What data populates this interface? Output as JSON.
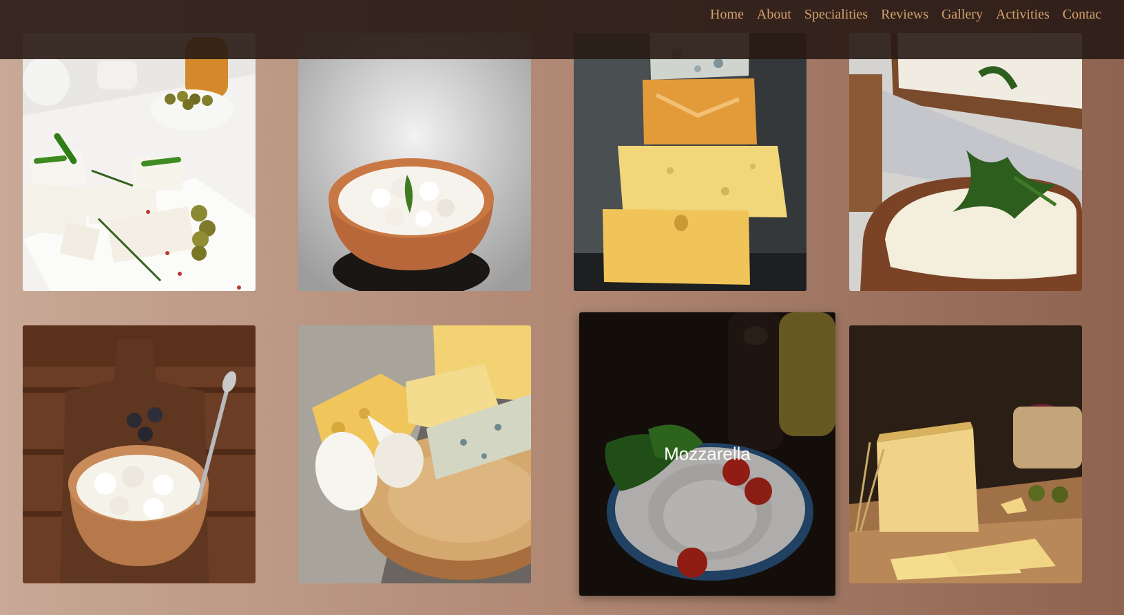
{
  "nav": {
    "items": [
      "Home",
      "About",
      "Specialities",
      "Reviews",
      "Gallery",
      "Activities",
      "Contac"
    ]
  },
  "gallery": {
    "tiles": [
      {
        "image": "feta-cheese-photo",
        "caption": ""
      },
      {
        "image": "cottage-cheese-bowl-photo",
        "caption": ""
      },
      {
        "image": "stacked-cheeses-photo",
        "caption": ""
      },
      {
        "image": "cream-cheese-toast-photo",
        "caption": ""
      },
      {
        "image": "cottage-cheese-wooden-bowl-photo",
        "caption": ""
      },
      {
        "image": "cheese-board-photo",
        "caption": ""
      },
      {
        "image": "mozzarella-photo",
        "caption": "Mozzarella"
      },
      {
        "image": "hard-cheese-wedge-photo",
        "caption": ""
      }
    ]
  },
  "colors": {
    "nav_link": "#d2a16e",
    "nav_background": "#2e1f18"
  }
}
